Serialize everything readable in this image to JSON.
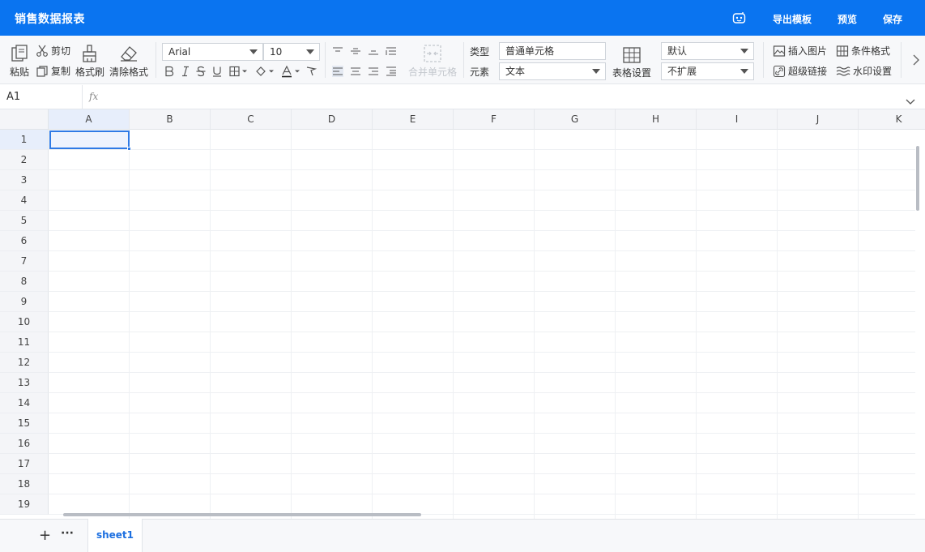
{
  "header": {
    "title": "销售数据报表",
    "export_template": "导出模板",
    "preview": "预览",
    "save": "保存",
    "bg_color": "#0a74f0"
  },
  "toolbar": {
    "paste": "粘贴",
    "cut": "剪切",
    "copy": "复制",
    "format_painter": "格式刷",
    "clear_format": "清除格式",
    "font_family": "Arial",
    "font_size": "10",
    "merge_cells": "合并单元格",
    "type_label": "类型",
    "type_value": "普通单元格",
    "element_label": "元素",
    "element_value": "文本",
    "table_settings": "表格设置",
    "default_select": "默认",
    "expand_select": "不扩展",
    "insert_image": "插入图片",
    "conditional_format": "条件格式",
    "hyperlink": "超级链接",
    "watermark": "水印设置"
  },
  "formula_bar": {
    "cell_ref": "A1",
    "fx": "fx"
  },
  "grid": {
    "columns": [
      "A",
      "B",
      "C",
      "D",
      "E",
      "F",
      "G",
      "H",
      "I",
      "J",
      "K"
    ],
    "rows": [
      "1",
      "2",
      "3",
      "4",
      "5",
      "6",
      "7",
      "8",
      "9",
      "10",
      "11",
      "12",
      "13",
      "14",
      "15",
      "16",
      "17",
      "18",
      "19"
    ],
    "selected_cell": "A1"
  },
  "sheets": {
    "add": "+",
    "more": "···",
    "tabs": [
      "sheet1"
    ]
  },
  "colors": {
    "accent": "#2f7ae5",
    "active_tab": "#1c6fe0"
  }
}
